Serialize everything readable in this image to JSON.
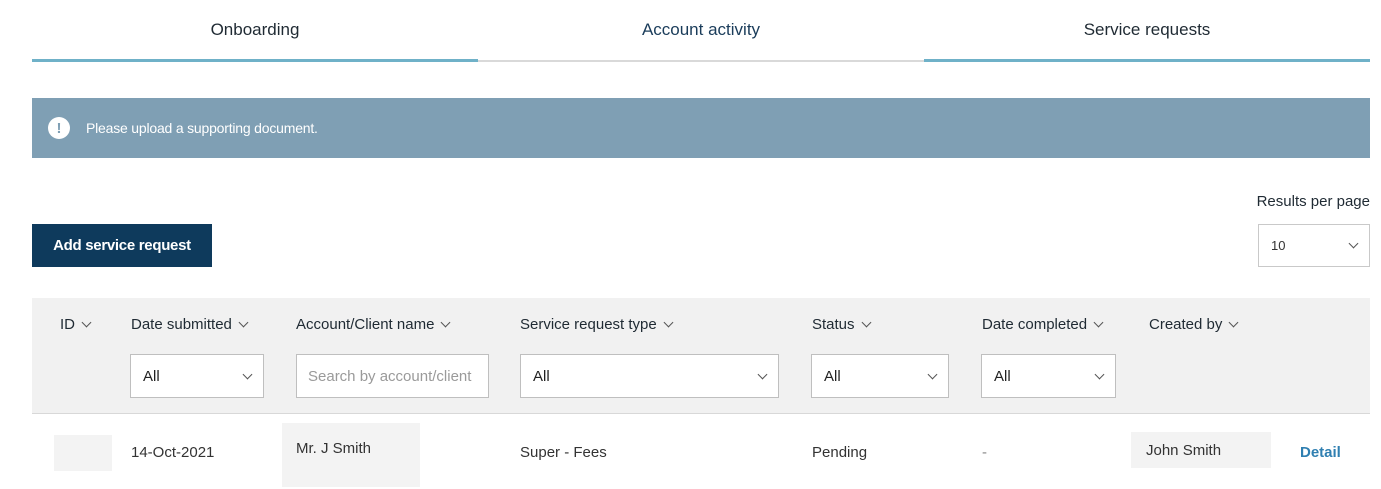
{
  "tabs": [
    {
      "label": "Onboarding"
    },
    {
      "label": "Account activity"
    },
    {
      "label": "Service requests"
    }
  ],
  "alert": {
    "icon": "!",
    "message": "Please upload a supporting document."
  },
  "toolbar": {
    "add_label": "Add service request",
    "rpp_label": "Results per page",
    "rpp_value": "10"
  },
  "table": {
    "columns": [
      {
        "label": "ID"
      },
      {
        "label": "Date submitted"
      },
      {
        "label": "Account/Client name"
      },
      {
        "label": "Service request type"
      },
      {
        "label": "Status"
      },
      {
        "label": "Date completed"
      },
      {
        "label": "Created by"
      }
    ],
    "filters": {
      "date_submitted": "All",
      "account_placeholder": "Search by account/client",
      "service_type": "All",
      "status": "All",
      "date_completed": "All"
    },
    "rows": [
      {
        "id": "",
        "date_submitted": "14-Oct-2021",
        "client_name": "Mr. J Smith",
        "service_type": "Super - Fees",
        "status": "Pending",
        "date_completed": "-",
        "created_by": "John Smith",
        "action": "Detail"
      }
    ]
  },
  "colors": {
    "tab_active_underline": "#6fb1c8",
    "alert_bg": "#7f9fb4",
    "primary_button": "#0e3a5c",
    "link": "#2f7fb1",
    "header_bg": "#f1f1f1"
  }
}
